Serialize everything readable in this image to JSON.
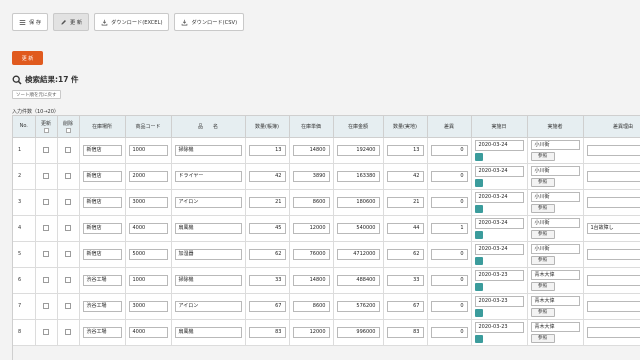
{
  "toolbar": {
    "save_label": "保 存",
    "update_label": "更 新",
    "excel_label": "ダウンロード(EXCEL)",
    "csv_label": "ダウンロード(CSV)"
  },
  "update_button": "更 新",
  "search_result": "検索結果:17 件",
  "reset_sort_label": "ソート順を元に戻す",
  "input_count": "入力件数（10→20）",
  "columns": {
    "no": "No.",
    "update": "更新",
    "delete": "削除",
    "location": "在庫場所",
    "product_code": "商品コード",
    "product_name": "品　　名",
    "qty_book": "数量(帳簿)",
    "unit_price": "在庫単価",
    "amount": "在庫金額",
    "qty_actual": "数量(実地)",
    "diff": "差異",
    "date": "実施日",
    "person": "実施者",
    "reason": "差異理由"
  },
  "rows": [
    {
      "no": "1",
      "location": "新宿店",
      "code": "1000",
      "name": "掃除機",
      "qty_book": "13",
      "price": "14800",
      "amount": "192400",
      "qty_actual": "13",
      "diff": "0",
      "date": "2020-03-24",
      "person": "小川街",
      "ref": "参照",
      "reason": ""
    },
    {
      "no": "2",
      "location": "新宿店",
      "code": "2000",
      "name": "ドライヤー",
      "qty_book": "42",
      "price": "3890",
      "amount": "163380",
      "qty_actual": "42",
      "diff": "0",
      "date": "2020-03-24",
      "person": "小川街",
      "ref": "参照",
      "reason": ""
    },
    {
      "no": "3",
      "location": "新宿店",
      "code": "3000",
      "name": "アイロン",
      "qty_book": "21",
      "price": "8600",
      "amount": "180600",
      "qty_actual": "21",
      "diff": "0",
      "date": "2020-03-24",
      "person": "小川街",
      "ref": "参照",
      "reason": ""
    },
    {
      "no": "4",
      "location": "新宿店",
      "code": "4000",
      "name": "扇風機",
      "qty_book": "45",
      "price": "12000",
      "amount": "540000",
      "qty_actual": "44",
      "diff": "1",
      "date": "2020-03-24",
      "person": "小川街",
      "ref": "参照",
      "reason": "1台故障し"
    },
    {
      "no": "5",
      "location": "新宿店",
      "code": "5000",
      "name": "加湿器",
      "qty_book": "62",
      "price": "76000",
      "amount": "4712000",
      "qty_actual": "62",
      "diff": "0",
      "date": "2020-03-24",
      "person": "小川街",
      "ref": "参照",
      "reason": ""
    },
    {
      "no": "6",
      "location": "渋谷工場",
      "code": "1000",
      "name": "掃除機",
      "qty_book": "33",
      "price": "14800",
      "amount": "488400",
      "qty_actual": "33",
      "diff": "0",
      "date": "2020-03-23",
      "person": "青木大偉",
      "ref": "参照",
      "reason": ""
    },
    {
      "no": "7",
      "location": "渋谷工場",
      "code": "3000",
      "name": "アイロン",
      "qty_book": "67",
      "price": "8600",
      "amount": "576200",
      "qty_actual": "67",
      "diff": "0",
      "date": "2020-03-23",
      "person": "青木大偉",
      "ref": "参照",
      "reason": ""
    },
    {
      "no": "8",
      "location": "渋谷工場",
      "code": "4000",
      "name": "扇風機",
      "qty_book": "83",
      "price": "12000",
      "amount": "996000",
      "qty_actual": "83",
      "diff": "0",
      "date": "2020-03-23",
      "person": "青木大偉",
      "ref": "参照",
      "reason": ""
    }
  ]
}
